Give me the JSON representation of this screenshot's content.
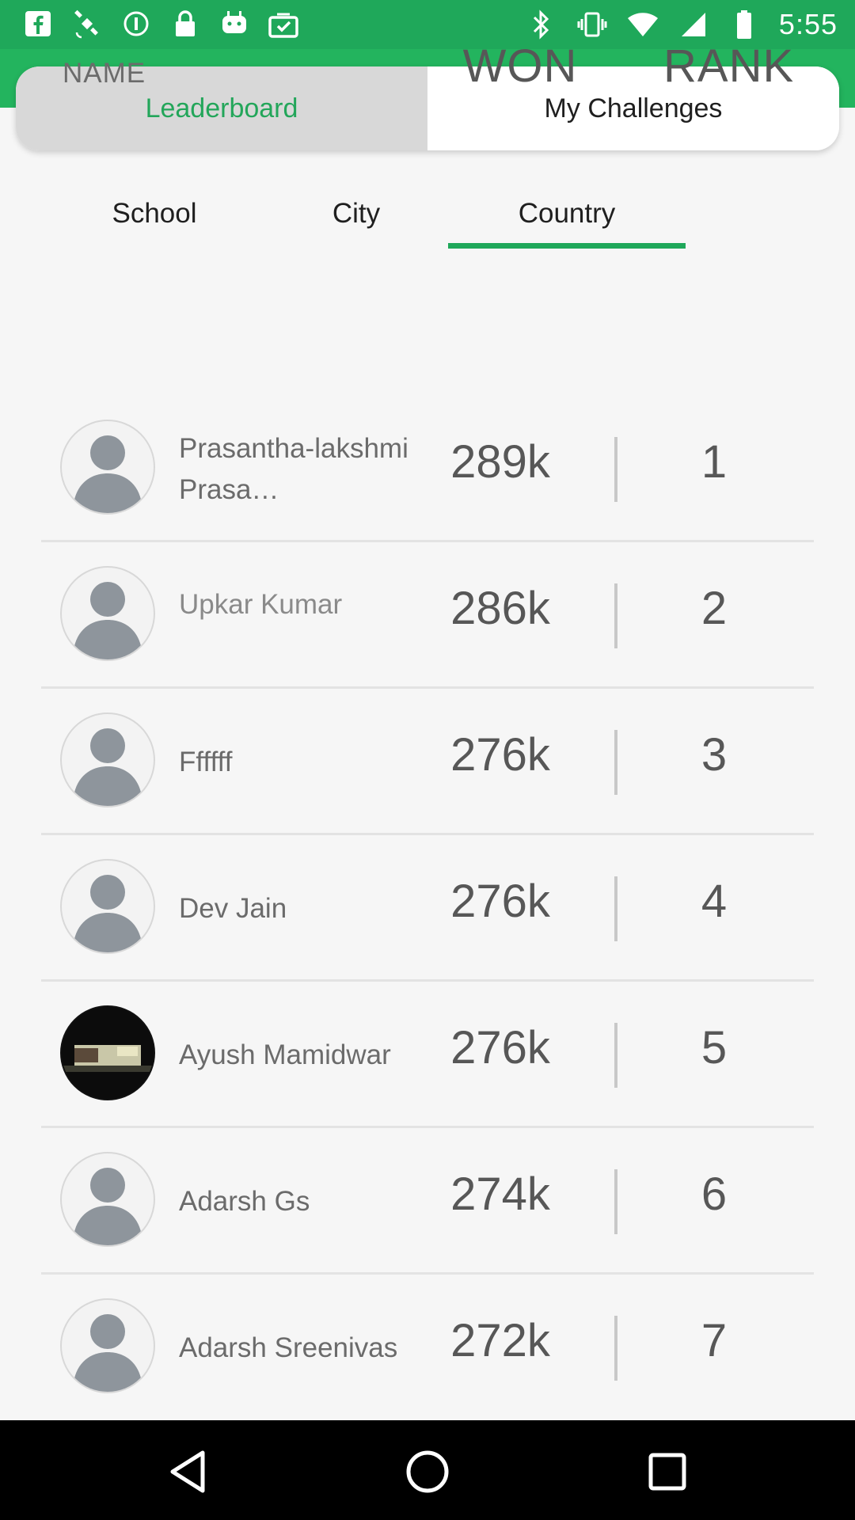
{
  "status_bar": {
    "time": "5:55",
    "left_icons": [
      "facebook-icon",
      "fake-gps-icon",
      "info-icon",
      "lock-icon",
      "android-icon",
      "task-icon"
    ],
    "right_icons": [
      "bluetooth-icon",
      "vibrate-icon",
      "wifi-icon",
      "signal-icon",
      "battery-icon"
    ]
  },
  "segments": {
    "leaderboard": "Leaderboard",
    "my_challenges": "My Challenges"
  },
  "subtabs": {
    "school": "School",
    "city": "City",
    "country": "Country"
  },
  "columns": {
    "name": "NAME",
    "won": "WON",
    "rank": "RANK"
  },
  "rows": [
    {
      "name": "Prasantha-lakshmi Prasa…",
      "won": "289k",
      "rank": "1",
      "avatar": "default-avatar-icon"
    },
    {
      "name": "Upkar Kumar",
      "won": "286k",
      "rank": "2",
      "avatar": "default-avatar-icon"
    },
    {
      "name": "Ffffff",
      "won": "276k",
      "rank": "3",
      "avatar": "default-avatar-icon"
    },
    {
      "name": "Dev Jain",
      "won": "276k",
      "rank": "4",
      "avatar": "default-avatar-icon"
    },
    {
      "name": "Ayush Mamidwar",
      "won": "276k",
      "rank": "5",
      "avatar": "photo-avatar"
    },
    {
      "name": "Adarsh Gs",
      "won": "274k",
      "rank": "6",
      "avatar": "default-avatar-icon"
    },
    {
      "name": "Adarsh Sreenivas",
      "won": "272k",
      "rank": "7",
      "avatar": "default-avatar-icon"
    }
  ],
  "colors": {
    "accent_green": "#1fa85a",
    "background": "#f6f6f6"
  }
}
